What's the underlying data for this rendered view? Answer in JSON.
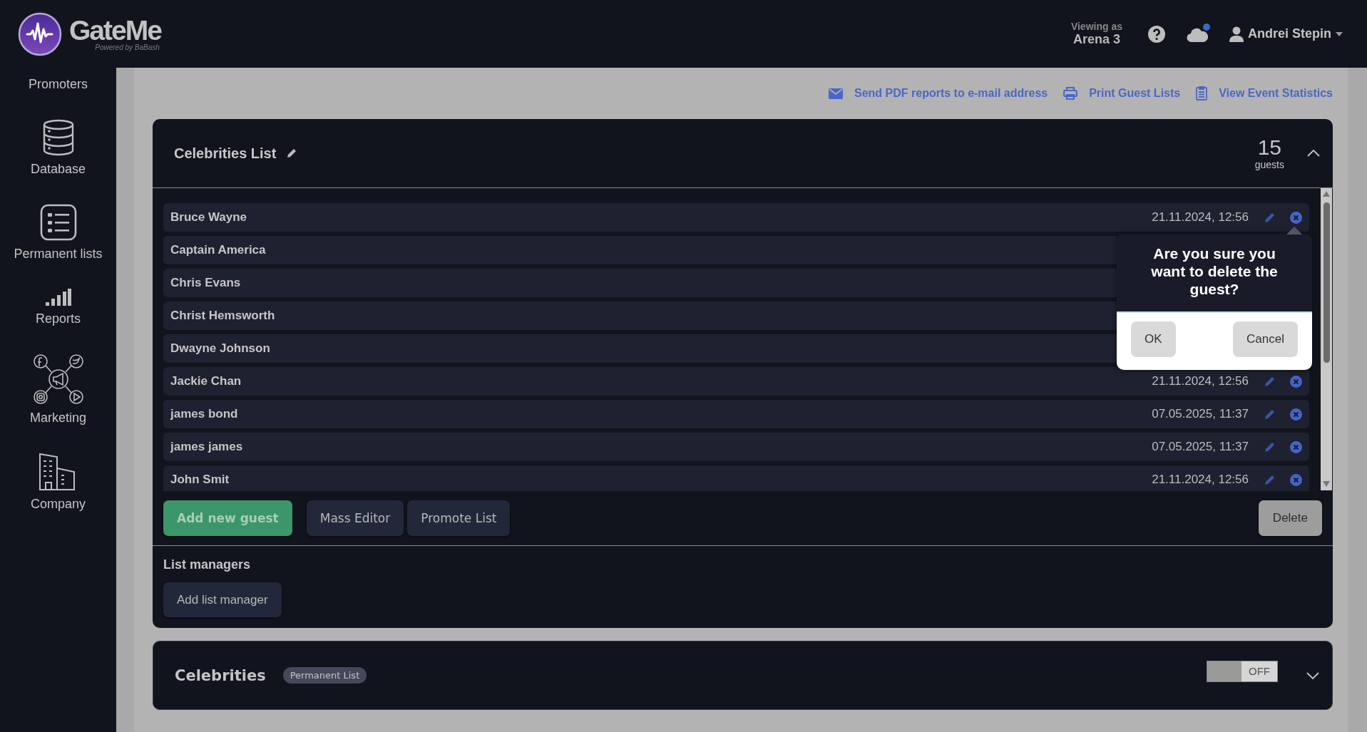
{
  "header": {
    "logo": {
      "name": "GateMe",
      "tagline": "Powered by BaBash"
    },
    "viewing_label": "Viewing as",
    "venue": "Arena 3",
    "notification": true,
    "user": "Andrei Stepin"
  },
  "sidebar": {
    "items": [
      {
        "label": "Promoters",
        "kind": "text"
      },
      {
        "label": "Database",
        "kind": "database"
      },
      {
        "label": "Permanent lists",
        "kind": "list"
      },
      {
        "label": "Reports",
        "kind": "bars"
      },
      {
        "label": "Marketing",
        "kind": "social"
      },
      {
        "label": "Company",
        "kind": "building"
      }
    ]
  },
  "actions": [
    {
      "label": "Send PDF reports to e-mail address",
      "kind": "mail"
    },
    {
      "label": "Print Guest Lists",
      "kind": "print"
    },
    {
      "label": "View Event Statistics",
      "kind": "clipboard"
    }
  ],
  "lists": [
    {
      "kind": "guest_list",
      "title": "Celebrities List",
      "count": "15",
      "count_label": "guests",
      "expanded": true,
      "guests": [
        {
          "name": "Bruce Wayne",
          "added": "21.11.2024, 12:56"
        },
        {
          "name": "Captain America"
        },
        {
          "name": "Chris Evans"
        },
        {
          "name": "Christ Hemsworth"
        },
        {
          "name": "Dwayne Johnson"
        },
        {
          "name": "Jackie Chan",
          "added": "21.11.2024, 12:56"
        },
        {
          "name": "james bond",
          "added": "07.05.2025, 11:37"
        },
        {
          "name": "james james",
          "added": "07.05.2025, 11:37"
        },
        {
          "name": "John Smit",
          "added": "21.11.2024, 12:56"
        }
      ],
      "buttons": [
        {
          "label": "Add new guest",
          "kind": "primary"
        },
        {
          "label": "Mass Editor",
          "kind": "secondary"
        },
        {
          "label": "Promote List",
          "kind": "secondary"
        }
      ],
      "delete_button": "Delete",
      "managers_title": "List managers",
      "add_manager_button": "Add list manager",
      "confirm": {
        "message": "Are you sure you want to delete the guest?",
        "ok": "OK",
        "cancel": "Cancel"
      }
    },
    {
      "kind": "permanent",
      "title": "Celebrities",
      "badge": "Permanent List",
      "toggle": {
        "on": false,
        "label": "OFF"
      },
      "expanded": false
    }
  ]
}
